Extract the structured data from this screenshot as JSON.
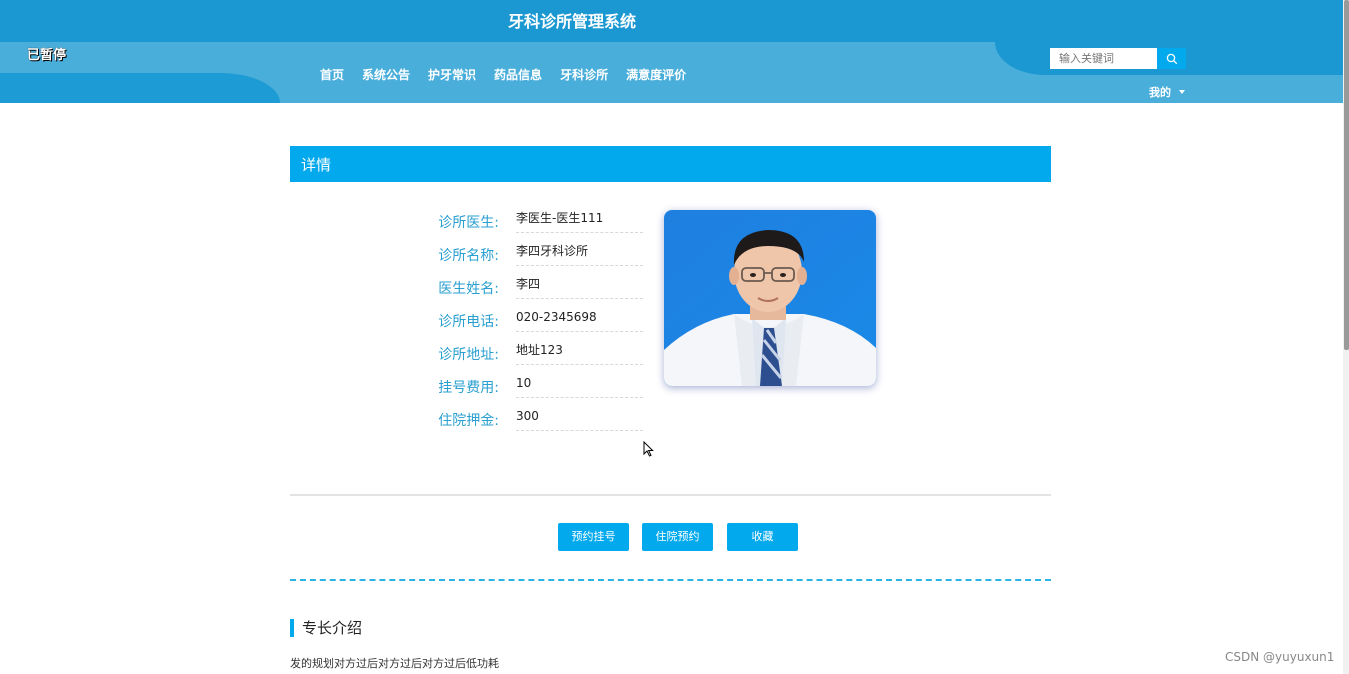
{
  "header": {
    "title": "牙科诊所管理系统",
    "paused": "已暂停",
    "nav": [
      "首页",
      "系统公告",
      "护牙常识",
      "药品信息",
      "牙科诊所",
      "满意度评价"
    ],
    "search_placeholder": "输入关键词",
    "mine": "我的"
  },
  "detail": {
    "heading": "详情",
    "fields": [
      {
        "label": "诊所医生:",
        "value": "李医生-医生111"
      },
      {
        "label": "诊所名称:",
        "value": "李四牙科诊所"
      },
      {
        "label": "医生姓名:",
        "value": "李四"
      },
      {
        "label": "诊所电话:",
        "value": "020-2345698"
      },
      {
        "label": "诊所地址:",
        "value": "地址123"
      },
      {
        "label": "挂号费用:",
        "value": "10"
      },
      {
        "label": "住院押金:",
        "value": "300"
      }
    ],
    "buttons": [
      "预约挂号",
      "住院预约",
      "收藏"
    ]
  },
  "section": {
    "title": "专长介绍",
    "text": "发的规划对方过后对方过后对方过后低功耗"
  },
  "watermark": "CSDN @yuyuxun1",
  "colors": {
    "primary": "#02a9ec",
    "header": "#1b98d2",
    "band": "#4aaedb",
    "label": "#2a9fd0"
  }
}
